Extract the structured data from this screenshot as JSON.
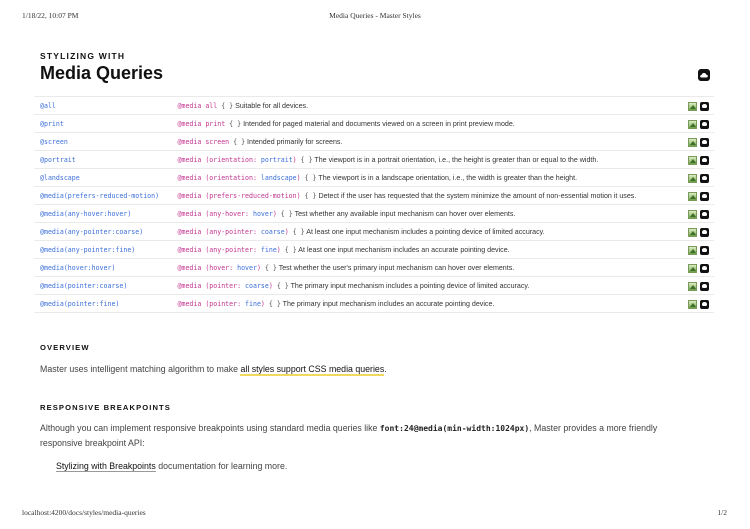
{
  "print_header": {
    "datetime": "1/18/22, 10:07 PM",
    "title": "Media Queries - Master Styles"
  },
  "print_footer": {
    "url": "localhost:4200/docs/styles/media-queries",
    "page": "1/2"
  },
  "page": {
    "eyebrow": "STYLIZING WITH",
    "title": "Media Queries"
  },
  "media_rows": [
    {
      "key": "@all",
      "at": "@media",
      "query": "all",
      "braces": "{ }",
      "description": "Suitable for all devices."
    },
    {
      "key": "@print",
      "at": "@media",
      "query": "print",
      "braces": "{ }",
      "description": "Intended for paged material and documents viewed on a screen in print preview mode."
    },
    {
      "key": "@screen",
      "at": "@media",
      "query": "screen",
      "braces": "{ }",
      "description": "Intended primarily for screens."
    },
    {
      "key": "@portrait",
      "at": "@media",
      "query_prefix": "(orientation:",
      "query_value": "portrait",
      "query_suffix": ")",
      "braces": "{ }",
      "description": "The viewport is in a portrait orientation, i.e., the height is greater than or equal to the width."
    },
    {
      "key": "@landscape",
      "at": "@media",
      "query_prefix": "(orientation:",
      "query_value": "landscape",
      "query_suffix": ")",
      "braces": "{ }",
      "description": "The viewport is in a landscape orientation, i.e., the width is greater than the height."
    },
    {
      "key": "@media(prefers-reduced-motion)",
      "at": "@media",
      "query_prefix": "(prefers-reduced-motion)",
      "braces": "{ }",
      "description": "Detect if the user has requested that the system minimize the amount of non-essential motion it uses."
    },
    {
      "key": "@media(any-hover:hover)",
      "at": "@media",
      "query_prefix": "(any-hover:",
      "query_value": "hover",
      "query_suffix": ")",
      "braces": "{ }",
      "description": "Test whether any available input mechanism can hover over elements."
    },
    {
      "key": "@media(any-pointer:coarse)",
      "at": "@media",
      "query_prefix": "(any-pointer:",
      "query_value": "coarse",
      "query_suffix": ")",
      "braces": "{ }",
      "description": "At least one input mechanism includes a pointing device of limited accuracy."
    },
    {
      "key": "@media(any-pointer:fine)",
      "at": "@media",
      "query_prefix": "(any-pointer:",
      "query_value": "fine",
      "query_suffix": ")",
      "braces": "{ }",
      "description": "At least one input mechanism includes an accurate pointing device."
    },
    {
      "key": "@media(hover:hover)",
      "at": "@media",
      "query_prefix": "(hover:",
      "query_value": "hover",
      "query_suffix": ")",
      "braces": "{ }",
      "description": "Test whether the user's primary input mechanism can hover over elements."
    },
    {
      "key": "@media(pointer:coarse)",
      "at": "@media",
      "query_prefix": "(pointer:",
      "query_value": "coarse",
      "query_suffix": ")",
      "braces": "{ }",
      "description": "The primary input mechanism includes a pointing device of limited accuracy."
    },
    {
      "key": "@media(pointer:fine)",
      "at": "@media",
      "query_prefix": "(pointer:",
      "query_value": "fine",
      "query_suffix": ")",
      "braces": "{ }",
      "description": "The primary input mechanism includes an accurate pointing device."
    }
  ],
  "row_icons": [
    "image-preview-icon",
    "dark-action-icon"
  ],
  "overview": {
    "heading": "OVERVIEW",
    "text_before": "Master uses intelligent matching algorithm to make ",
    "highlight": "all styles support CSS media queries",
    "text_after": "."
  },
  "breakpoints": {
    "heading": "RESPONSIVE BREAKPOINTS",
    "text_before": "Although you can implement responsive breakpoints using standard media queries like ",
    "code": "font:24@media(min-width:1024px)",
    "text_after": ", Master provides a more friendly responsive breakpoint API:",
    "link": "Stylizing with Breakpoints",
    "link_suffix": " documentation for learning more."
  },
  "colors": {
    "key": "#3b6fd9",
    "keyword": "#c2338f",
    "highlight": "#f2d95c"
  }
}
